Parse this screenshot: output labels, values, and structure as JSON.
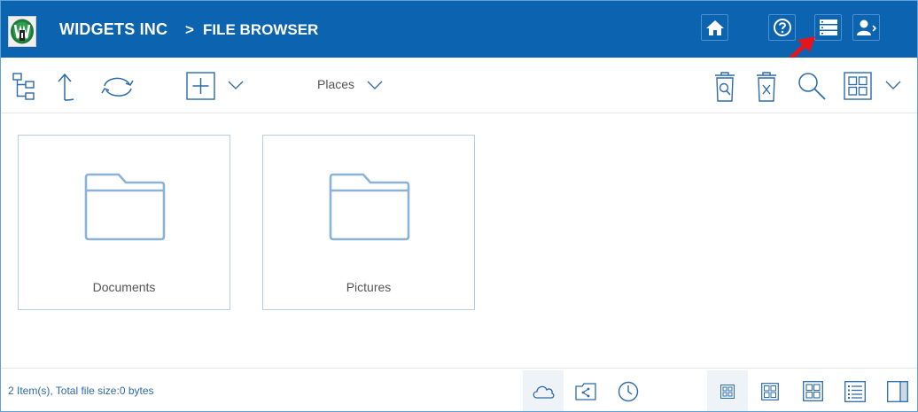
{
  "header": {
    "brand": "WIDGETS INC",
    "separator": ">",
    "crumb": "FILE BROWSER",
    "colors": {
      "background": "#0c63b0",
      "text": "#ffffff"
    },
    "buttons": [
      {
        "name": "home-button",
        "icon": "home-icon"
      },
      {
        "name": "help-button",
        "icon": "help-icon"
      },
      {
        "name": "storage-button",
        "icon": "server-icon"
      },
      {
        "name": "user-button",
        "icon": "user-icon"
      }
    ],
    "annotation": {
      "icon": "red-arrow-icon",
      "color": "#e8141b"
    }
  },
  "toolbar": {
    "places_label": "Places",
    "icons": [
      "folder-tree-icon",
      "up-arrow-icon",
      "refresh-icon",
      "add-icon",
      "chevron-down-icon",
      "search-trash-icon",
      "empty-trash-icon",
      "search-icon",
      "view-grid-icon",
      "chevron-down-icon"
    ]
  },
  "items": [
    {
      "name": "Documents",
      "icon": "folder-icon"
    },
    {
      "name": "Pictures",
      "icon": "folder-icon"
    }
  ],
  "footer": {
    "status": "2 Item(s), Total file size:0 bytes",
    "source_buttons": [
      "cloud-icon",
      "share-icon",
      "clock-icon"
    ],
    "view_buttons": [
      "small-grid-icon",
      "medium-grid-icon",
      "large-grid-icon",
      "list-icon",
      "details-panel-icon"
    ]
  },
  "colors": {
    "icon": "#2c6aa8",
    "folder": "#8ab3d6",
    "border": "#b7cde0"
  }
}
